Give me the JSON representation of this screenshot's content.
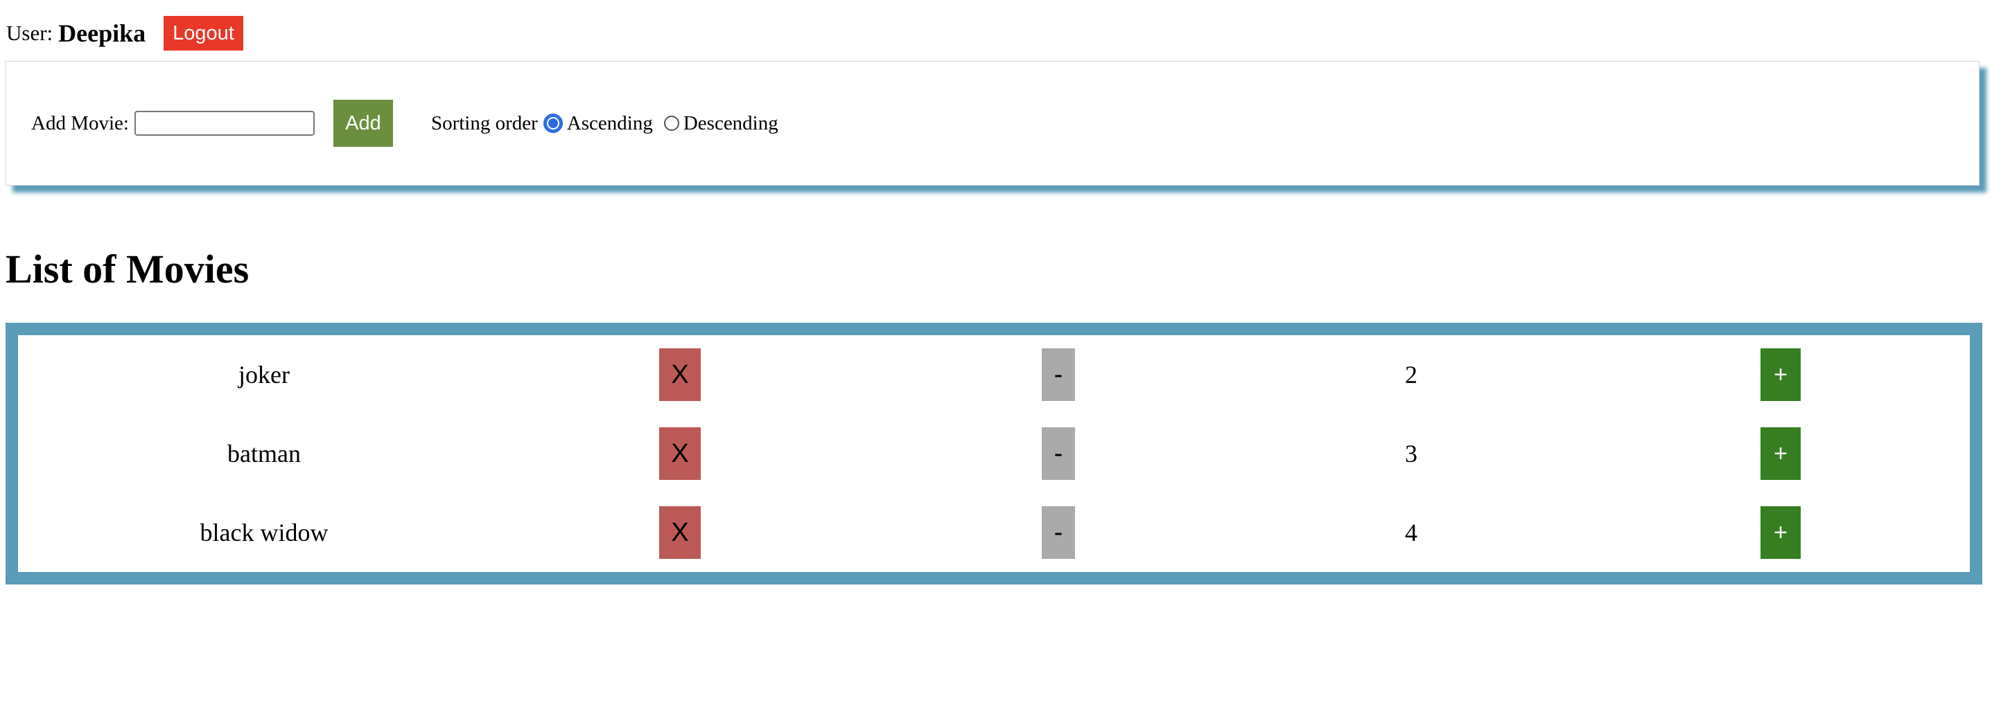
{
  "header": {
    "user_label": "User:",
    "user_name": "Deepika",
    "logout_label": "Logout"
  },
  "controls": {
    "add_movie_label": "Add Movie:",
    "add_movie_value": "",
    "add_button_label": "Add",
    "sorting_label": "Sorting order",
    "sort_options": [
      {
        "label": "Ascending",
        "checked": true
      },
      {
        "label": "Descending",
        "checked": false
      }
    ]
  },
  "main": {
    "title": "List of Movies",
    "remove_label": "X",
    "decrement_label": "-",
    "increment_label": "+",
    "movies": [
      {
        "name": "joker",
        "count": "2"
      },
      {
        "name": "batman",
        "count": "3"
      },
      {
        "name": "black widow",
        "count": "4"
      }
    ]
  },
  "colors": {
    "logout_bg": "#e8382a",
    "add_bg": "#6b8f3e",
    "panel_shadow": "#5b9cb8",
    "table_border": "#5b9cb8",
    "remove_bg": "#bb5a56",
    "decrement_bg": "#aaaaaa",
    "increment_bg": "#377e22",
    "radio_checked": "#2a6be0"
  }
}
